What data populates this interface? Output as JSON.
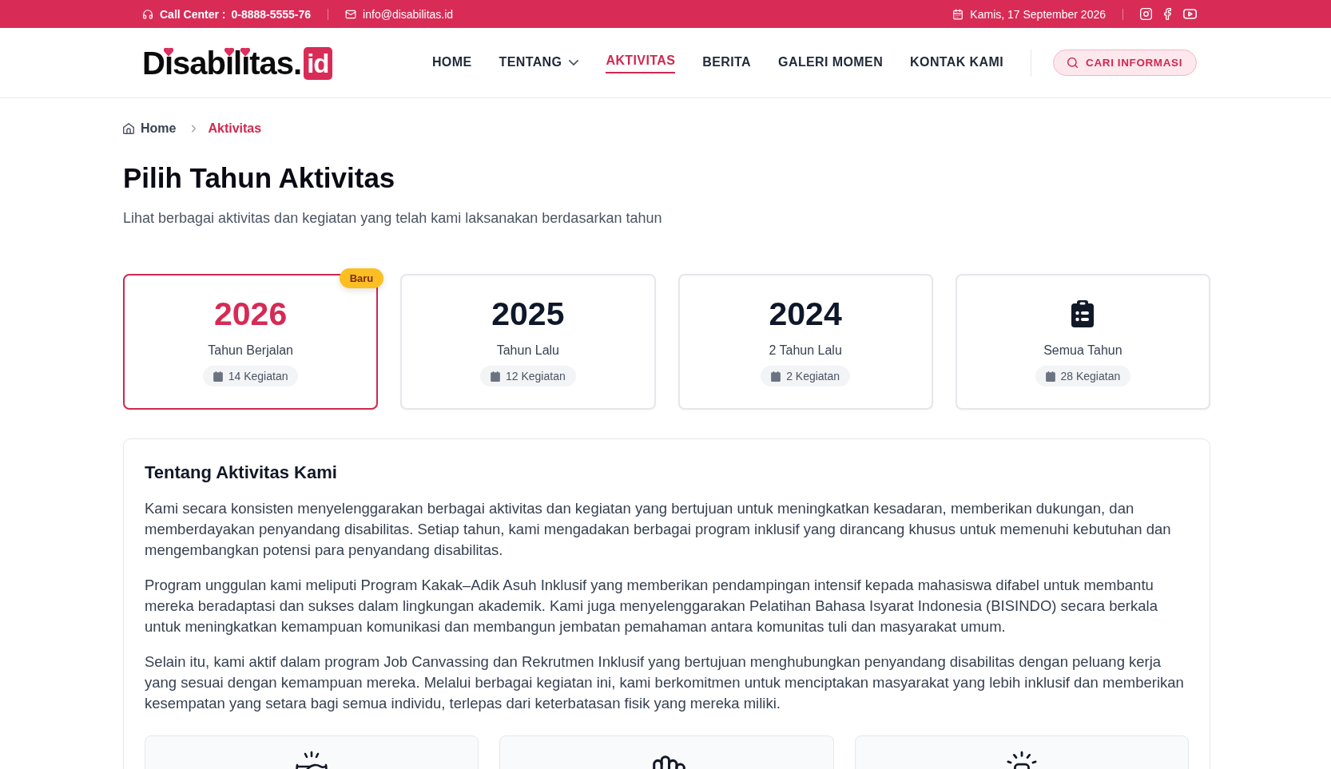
{
  "top_bar": {
    "call_center_label": "Call Center :",
    "call_center_number": "0-8888-5555-76",
    "email": "info@disabilitas.id",
    "date": "Kamis, 17 September 2026"
  },
  "header": {
    "logo": {
      "text": "Disabilitas.",
      "suffix": "id"
    },
    "nav": [
      {
        "label": "HOME",
        "selected": false,
        "dropdown": false
      },
      {
        "label": "TENTANG",
        "selected": false,
        "dropdown": true
      },
      {
        "label": "AKTIVITAS",
        "selected": true,
        "dropdown": false
      },
      {
        "label": "BERITA",
        "selected": false,
        "dropdown": false
      },
      {
        "label": "GALERI MOMEN",
        "selected": false,
        "dropdown": false
      },
      {
        "label": "KONTAK KAMI",
        "selected": false,
        "dropdown": false
      }
    ],
    "search_button": "CARI INFORMASI"
  },
  "breadcrumb": [
    {
      "label": "Home",
      "current": false
    },
    {
      "label": "Aktivitas",
      "current": true
    }
  ],
  "page_title": "Pilih Tahun Aktivitas",
  "page_subtitle": "Lihat berbagai aktivitas dan kegiatan yang telah kami laksanakan berdasarkan tahun",
  "year_cards": [
    {
      "kind": "year",
      "year": "2026",
      "label": "Tahun Berjalan",
      "count": "14 Kegiatan",
      "selected": true,
      "badge": "Baru"
    },
    {
      "kind": "year",
      "year": "2025",
      "label": "Tahun Lalu",
      "count": "12 Kegiatan",
      "selected": false
    },
    {
      "kind": "year",
      "year": "2024",
      "label": "2 Tahun Lalu",
      "count": "2 Kegiatan",
      "selected": false
    },
    {
      "kind": "all",
      "label": "Semua Tahun",
      "count": "28 Kegiatan",
      "selected": false
    }
  ],
  "about": {
    "title": "Tentang Aktivitas Kami",
    "paragraphs": [
      "Kami secara konsisten menyelenggarakan berbagai aktivitas dan kegiatan yang bertujuan untuk meningkatkan kesadaran, memberikan dukungan, dan memberdayakan penyandang disabilitas. Setiap tahun, kami mengadakan berbagai program inklusif yang dirancang khusus untuk memenuhi kebutuhan dan mengembangkan potensi para penyandang disabilitas.",
      "Program unggulan kami meliputi Program Kakak–Adik Asuh Inklusif yang memberikan pendampingan intensif kepada mahasiswa difabel untuk membantu mereka beradaptasi dan sukses dalam lingkungan akademik. Kami juga menyelenggarakan Pelatihan Bahasa Isyarat Indonesia (BISINDO) secara berkala untuk meningkatkan kemampuan komunikasi dan membangun jembatan pemahaman antara komunitas tuli dan masyarakat umum.",
      "Selain itu, kami aktif dalam program Job Canvassing dan Rekrutmen Inklusif yang bertujuan menghubungkan penyandang disabilitas dengan peluang kerja yang sesuai dengan kemampuan mereka. Melalui berbagai kegiatan ini, kami berkomitmen untuk menciptakan masyarakat yang lebih inklusif dan memberikan kesempatan yang setara bagi semua individu, terlepas dari keterbatasan fisik yang mereka miliki."
    ]
  }
}
